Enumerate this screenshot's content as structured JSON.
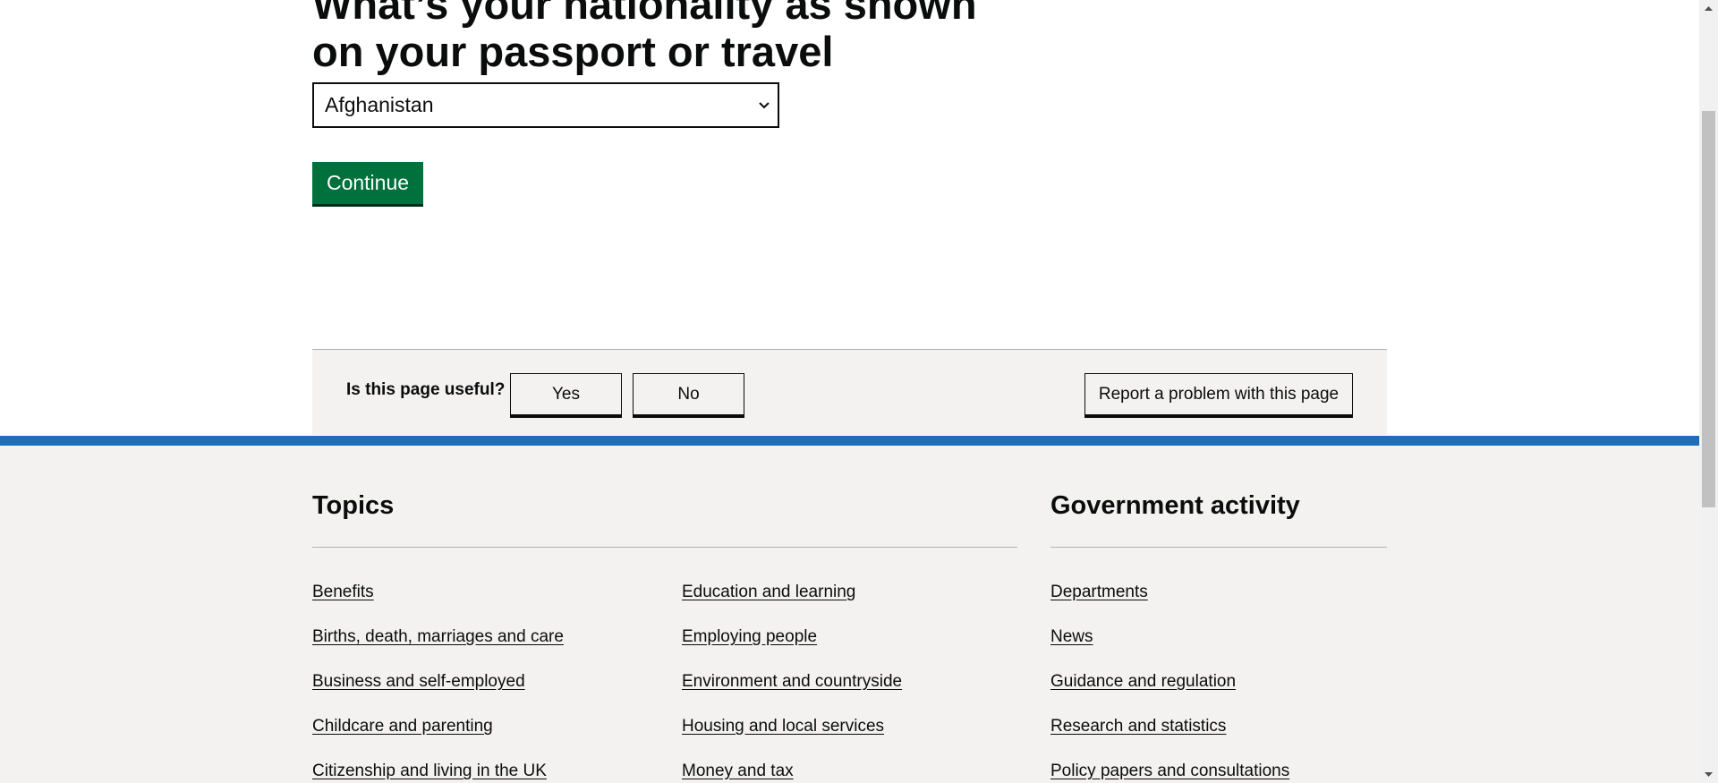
{
  "question": {
    "title": "What’s your nationality as shown on your passport or travel document?",
    "select_value": "Afghanistan",
    "continue_label": "Continue"
  },
  "feedback": {
    "question": "Is this page useful?",
    "yes_label": "Yes",
    "no_label": "No",
    "report_label": "Report a problem with this page"
  },
  "footer": {
    "topics_heading": "Topics",
    "gov_heading": "Government activity",
    "topics_col1": [
      "Benefits",
      "Births, death, marriages and care",
      "Business and self-employed",
      "Childcare and parenting",
      "Citizenship and living in the UK"
    ],
    "topics_col2": [
      "Education and learning",
      "Employing people",
      "Environment and countryside",
      "Housing and local services",
      "Money and tax"
    ],
    "gov_links": [
      "Departments",
      "News",
      "Guidance and regulation",
      "Research and statistics",
      "Policy papers and consultations"
    ]
  },
  "colors": {
    "continue_green": "#00703c",
    "footer_blue": "#1d70b8",
    "footer_bg": "#f3f2f1",
    "text": "#0b0c0c"
  },
  "icons": {
    "select_chevron": "chevron-down-icon",
    "scroll_up": "arrow-up-icon",
    "scroll_down": "arrow-down-icon"
  }
}
